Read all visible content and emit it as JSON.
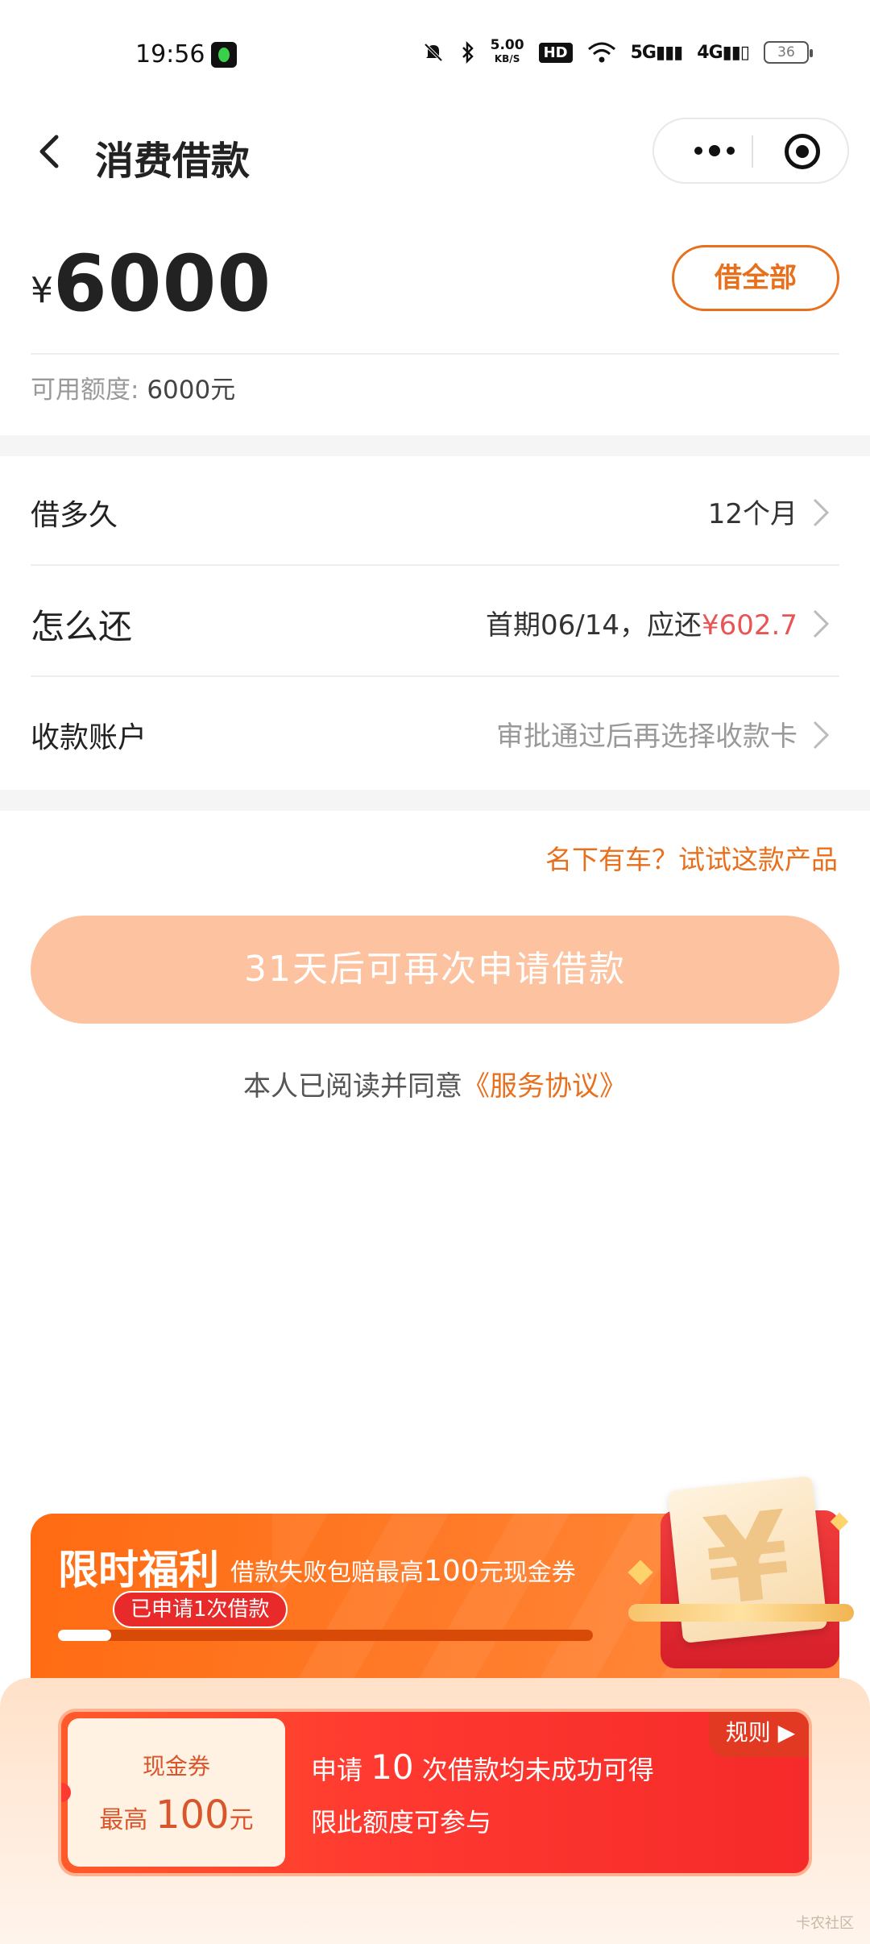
{
  "status_bar": {
    "time": "19:56",
    "net_speed_value": "5.00",
    "net_speed_unit": "KB/S",
    "hd": "HD",
    "sig5g": "5G",
    "sig4g": "4G",
    "battery": "36",
    "icons": [
      "app-icon",
      "mute-icon",
      "bluetooth-icon",
      "wifi-icon",
      "signal-icon",
      "battery-icon"
    ]
  },
  "nav": {
    "title": "消费借款",
    "back_icon": "back-chevron-icon",
    "more_icon": "more-dots-icon",
    "close_icon": "target-icon"
  },
  "amount": {
    "currency": "¥",
    "value": "6000",
    "borrow_all_label": "借全部",
    "limit_label": "可用额度:",
    "limit_value": "6000元"
  },
  "rows": [
    {
      "label": "借多久",
      "value": "12个月"
    },
    {
      "label": "怎么还",
      "value_prefix": "首期06/14，应还",
      "value_amount": "¥602.7"
    },
    {
      "label": "收款账户",
      "value": "审批通过后再选择收款卡"
    }
  ],
  "car_link": "名下有车？试试这款产品",
  "apply_button": "31天后可再次申请借款",
  "agreement": {
    "prefix": "本人已阅读并同意",
    "link": "《服务协议》"
  },
  "promo": {
    "title": "限时福利",
    "sub_prefix": "借款失败包赔最高",
    "sub_amount": "100",
    "sub_suffix": "元现金券",
    "applied_badge": "已申请1次借款",
    "progress": 0.1,
    "coupon_type": "现金券",
    "coupon_prefix": "最高",
    "coupon_amount": "100",
    "coupon_unit": "元",
    "desc_prefix": "申请",
    "desc_count": "10",
    "desc_suffix": "次借款均未成功可得",
    "desc_line2": "限此额度可参与",
    "rules_label": "规则 ▶",
    "envelope_symbol": "¥"
  },
  "watermark": "卡农社区",
  "colors": {
    "accent": "#e8701d",
    "apply_button_bg": "#fdc29f",
    "repay_red": "#e85555",
    "promo_orange": "#ff6b12",
    "coupon_red": "#f52a2a"
  }
}
